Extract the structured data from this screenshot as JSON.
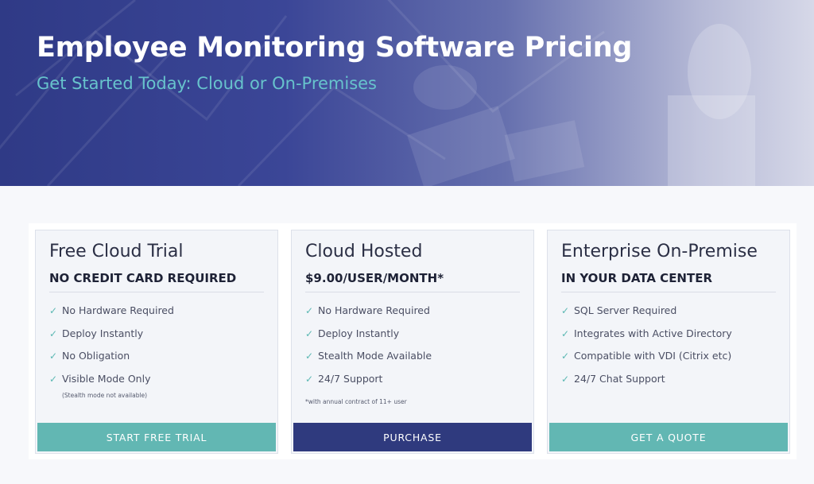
{
  "hero": {
    "title": "Employee Monitoring Software Pricing",
    "subtitle": "Get Started Today: Cloud or On-Premises"
  },
  "plans": [
    {
      "title": "Free Cloud Trial",
      "subtitle": "NO CREDIT CARD REQUIRED",
      "features": [
        "No Hardware Required",
        "Deploy Instantly",
        "No Obligation",
        "Visible Mode Only"
      ],
      "note": "(Stealth mode not available)",
      "cta": "START FREE TRIAL"
    },
    {
      "title": "Cloud Hosted",
      "subtitle": "$9.00/USER/MONTH*",
      "features": [
        "No Hardware Required",
        "Deploy Instantly",
        "Stealth Mode Available",
        "24/7 Support"
      ],
      "note": "*with annual contract of 11+ user",
      "cta": "PURCHASE"
    },
    {
      "title": "Enterprise On-Premise",
      "subtitle": "IN YOUR DATA CENTER",
      "features": [
        "SQL Server Required",
        "Integrates with Active Directory",
        "Compatible with VDI (Citrix etc)",
        "24/7 Chat Support"
      ],
      "cta": "GET A QUOTE"
    }
  ],
  "icons": {
    "check": "✓"
  },
  "colors": {
    "hero": "#3b4697",
    "accent_teal": "#62b7b3",
    "primary_navy": "#2f3a7e",
    "subtitle_teal": "#67c3cc"
  }
}
